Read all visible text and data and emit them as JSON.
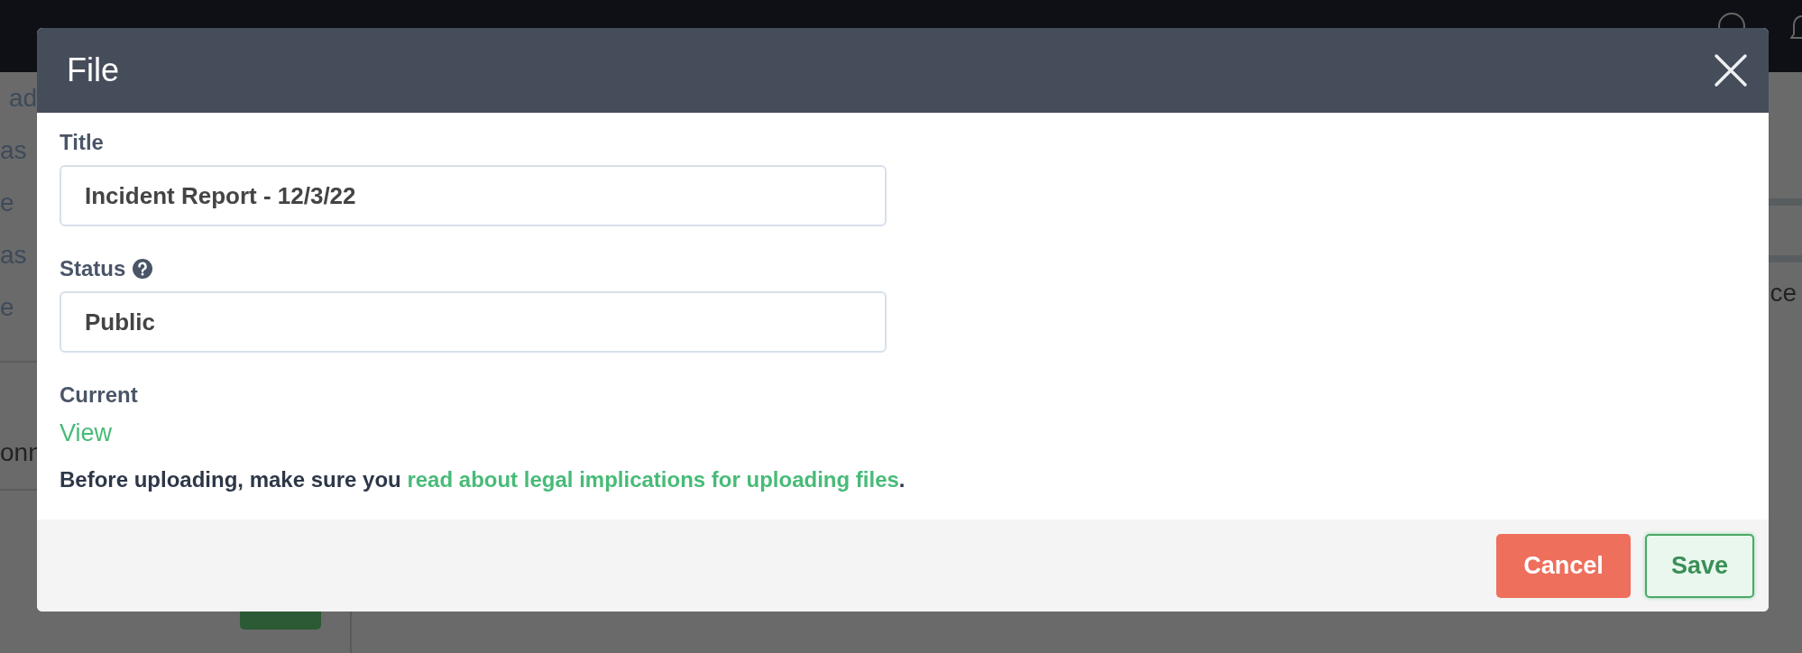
{
  "background": {
    "sidebar_items": [
      "ad",
      "as",
      "e",
      "as",
      "e"
    ],
    "sidebar_text": "onn",
    "right_text": "ce"
  },
  "dialog": {
    "title": "File",
    "fields": [
      {
        "label": "Title",
        "value": "Incident Report - 12/3/22",
        "help": false
      },
      {
        "label": "Status",
        "value": "Public",
        "help": true
      }
    ],
    "current_label": "Current",
    "view_link": "View",
    "notice": "Before uploading, make sure you ",
    "notice_link": "read about legal implications for uploading files",
    "notice_end": ".",
    "buttons": [
      {
        "label": "Cancel",
        "kind": "danger"
      },
      {
        "label": "Save",
        "kind": "primary"
      }
    ]
  }
}
